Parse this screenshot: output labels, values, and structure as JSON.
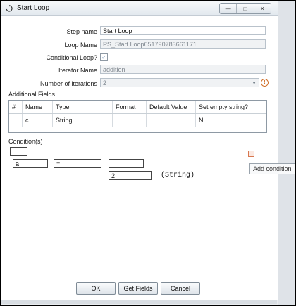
{
  "window": {
    "title": "Start Loop",
    "controls": [
      "—",
      "□",
      "✕"
    ]
  },
  "form": {
    "step_name_label": "Step name",
    "step_name_value": "Start Loop",
    "loop_name_label": "Loop Name",
    "loop_name_value": "PS_Start Loop651790783661171",
    "conditional_loop_label": "Conditional Loop?",
    "conditional_loop_checked": true,
    "iterator_name_label": "Iterator Name",
    "iterator_name_value": "addition",
    "iterations_label": "Number of iterations",
    "iterations_value": "2"
  },
  "additional_fields": {
    "label": "Additional Fields",
    "columns": [
      "#",
      "Name",
      "Type",
      "Format",
      "Default Value",
      "Set empty string?"
    ],
    "rows": [
      {
        "num": "",
        "name": "c",
        "type": "String",
        "format": "",
        "default": "",
        "empty": "N"
      }
    ]
  },
  "conditions": {
    "label": "Condition(s)",
    "left_operand": "a",
    "operator": "=",
    "right_operand": "",
    "value": "2",
    "value_type": "(String)",
    "add_tooltip": "Add condition"
  },
  "buttons": {
    "ok": "OK",
    "get_fields": "Get Fields",
    "cancel": "Cancel"
  },
  "colors": {
    "dialog_bg": "#ffffff",
    "frame_bg": "#e9ecef",
    "warning": "#d0702a"
  }
}
